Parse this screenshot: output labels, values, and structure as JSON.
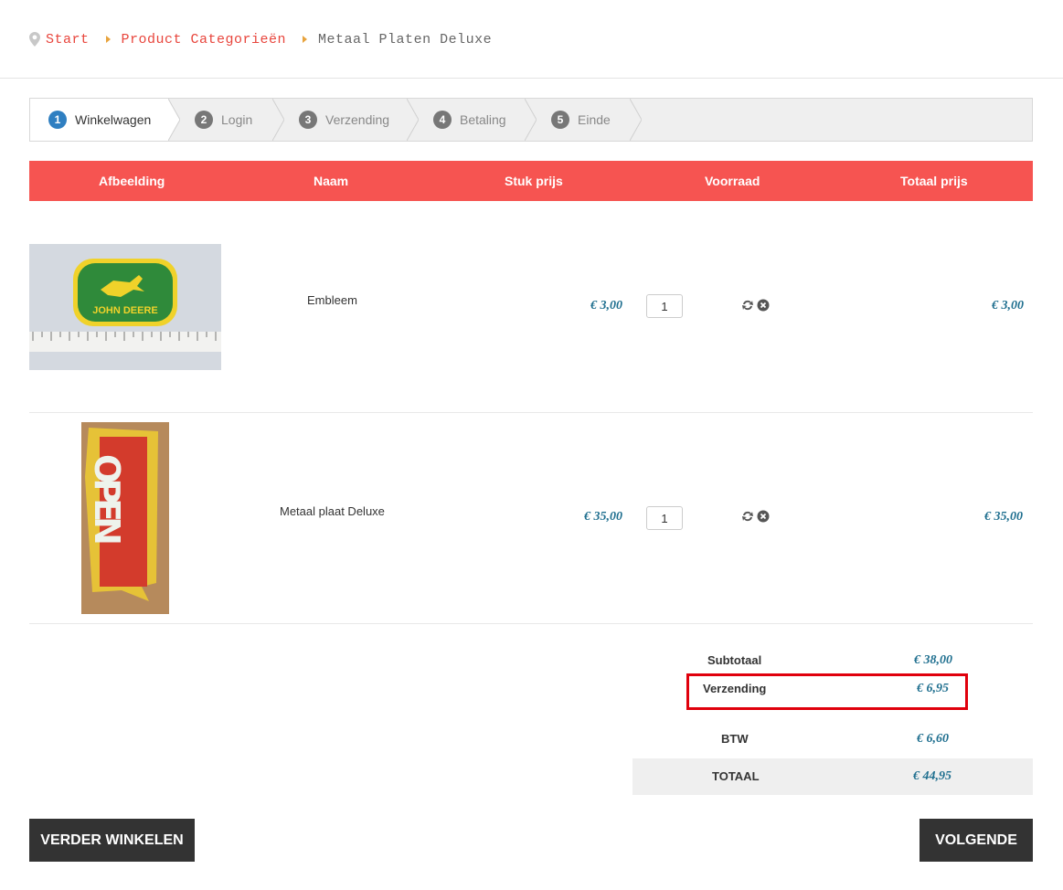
{
  "breadcrumb": {
    "items": [
      "Start",
      "Product Categorieën",
      "Metaal Platen Deluxe"
    ]
  },
  "steps": [
    {
      "num": "1",
      "label": "Winkelwagen"
    },
    {
      "num": "2",
      "label": "Login"
    },
    {
      "num": "3",
      "label": "Verzending"
    },
    {
      "num": "4",
      "label": "Betaling"
    },
    {
      "num": "5",
      "label": "Einde"
    }
  ],
  "table": {
    "headers": [
      "Afbeelding",
      "Naam",
      "Stuk prijs",
      "Voorraad",
      "Totaal prijs"
    ],
    "rows": [
      {
        "name": "Embleem",
        "unit_price": "€ 3,00",
        "qty": "1",
        "total": "€ 3,00",
        "image_text": "JOHN DEERE"
      },
      {
        "name": "Metaal plaat Deluxe",
        "unit_price": "€ 35,00",
        "qty": "1",
        "total": "€ 35,00",
        "image_text": "OPEN"
      }
    ]
  },
  "totals": {
    "subtotal_label": "Subtotaal",
    "subtotal": "€ 38,00",
    "shipping_label": "Verzending",
    "shipping": "€ 6,95",
    "tax_label": "BTW",
    "tax": "€ 6,60",
    "total_label": "TOTAAL",
    "total": "€ 44,95"
  },
  "buttons": {
    "continue_shopping": "VERDER WINKELEN",
    "next": "VOLGENDE"
  },
  "colors": {
    "accent": "#f65451",
    "price": "#1f6f8f",
    "highlight": "#e0000c",
    "active_step": "#2f7fc1"
  }
}
